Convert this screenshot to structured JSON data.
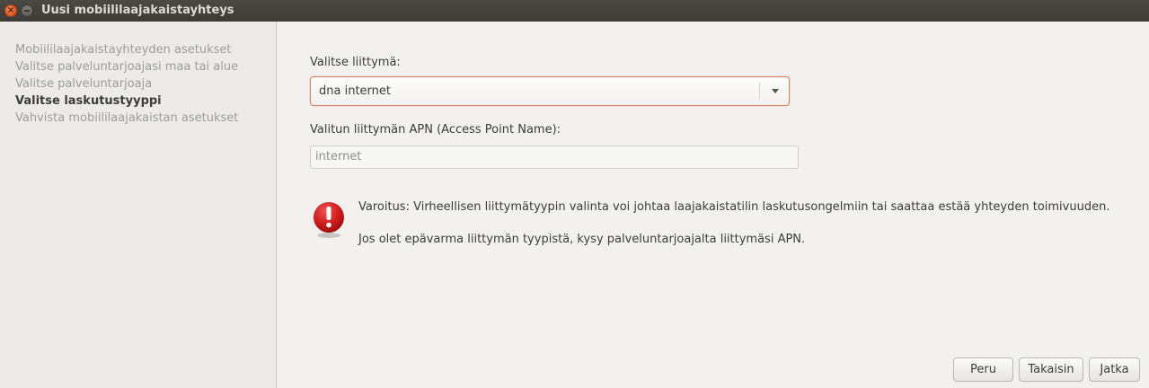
{
  "window": {
    "title": "Uusi mobiililaajakaistayhteys",
    "close_glyph": "×"
  },
  "sidebar": {
    "steps": [
      {
        "label": "Mobiililaajakaistayhteyden asetukset",
        "active": false
      },
      {
        "label": "Valitse palveluntarjoajasi maa tai alue",
        "active": false
      },
      {
        "label": "Valitse palveluntarjoaja",
        "active": false
      },
      {
        "label": "Valitse laskutustyyppi",
        "active": true
      },
      {
        "label": "Vahvista mobiililaajakaistan asetukset",
        "active": false
      }
    ]
  },
  "form": {
    "plan_label": "Valitse liittymä:",
    "plan_value": "dna internet",
    "apn_label": "Valitun liittymän APN (Access Point Name):",
    "apn_value": "internet"
  },
  "warning": {
    "icon": "warning-icon",
    "line1": "Varoitus: Virheellisen liittymätyypin valinta voi johtaa laajakaistatilin laskutusongelmiin tai saattaa estää yhteyden toimivuuden.",
    "line2": "Jos olet epävarma liittymän tyypistä, kysy palveluntarjoajalta liittymäsi APN."
  },
  "buttons": {
    "cancel": "Peru",
    "back": "Takaisin",
    "next": "Jatka"
  },
  "colors": {
    "titlebar": "#3c3b37",
    "accent_focus": "#dd7e5a",
    "warning_red": "#d21c1c",
    "close_button": "#e2541b"
  }
}
